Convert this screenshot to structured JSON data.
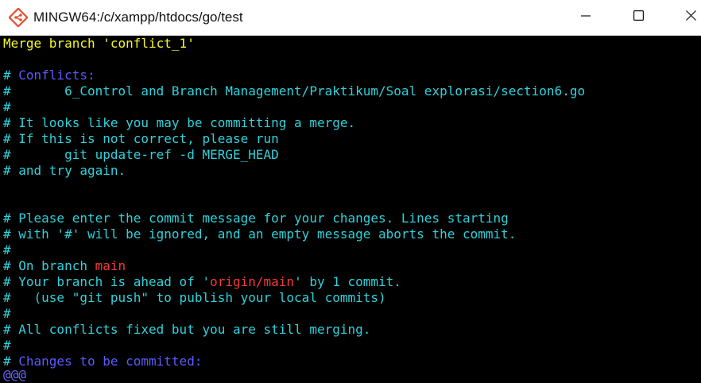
{
  "window": {
    "title": "MINGW64:/c/xampp/htdocs/go/test",
    "app_icon": "git-bash-icon",
    "controls": [
      "minimize-icon",
      "maximize-icon",
      "close-icon"
    ]
  },
  "colors": {
    "background": "#000000",
    "subject": "#f7f72f",
    "comment": "#2fd2dc",
    "heading": "#5b5bff",
    "branch": "#f23a3a"
  },
  "editor": {
    "subject_line": "Merge branch 'conflict_1'",
    "lines": {
      "l3_hash": "# ",
      "l3_heading": "Conflicts:",
      "l4": "#       6_Control and Branch Management/Praktikum/Soal explorasi/section6.go",
      "l5": "#",
      "l6": "# It looks like you may be committing a merge.",
      "l7": "# If this is not correct, please run",
      "l8": "#       git update-ref -d MERGE_HEAD",
      "l9": "# and try again.",
      "l12": "# Please enter the commit message for your changes. Lines starting",
      "l13": "# with '#' will be ignored, and an empty message aborts the commit.",
      "l14": "#",
      "l15_pre": "# On branch ",
      "l15_branch": "main",
      "l16_pre": "# Your branch is ahead of '",
      "l16_branch": "origin/main",
      "l16_post": "' by 1 commit.",
      "l17": "#   (use \"git push\" to publish your local commits)",
      "l18": "#",
      "l19": "# All conflicts fixed but you are still merging.",
      "l20": "#",
      "l21_hash": "# ",
      "l21_heading": "Changes to be committed:",
      "l22": "@@@"
    }
  }
}
